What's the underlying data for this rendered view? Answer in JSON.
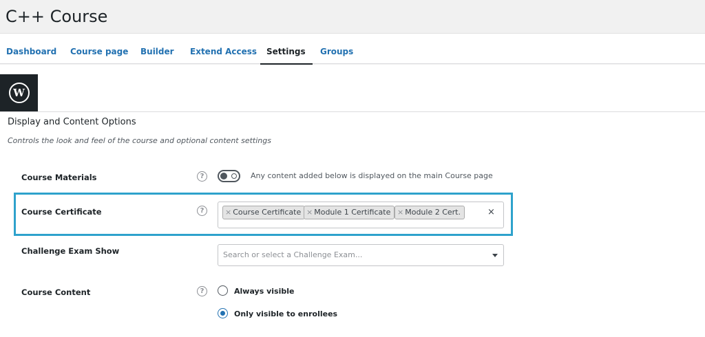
{
  "page": {
    "title": "C++ Course"
  },
  "tabs": [
    {
      "label": "Dashboard"
    },
    {
      "label": "Course page"
    },
    {
      "label": "Builder"
    },
    {
      "label": "Extend Access"
    },
    {
      "label": "Settings",
      "active": true
    },
    {
      "label": "Groups"
    }
  ],
  "section": {
    "title": "Display and Content Options",
    "description": "Controls the look and feel of the course and optional content settings"
  },
  "course_materials": {
    "label": "Course Materials",
    "help_glyph": "?",
    "enabled": false,
    "description": "Any content added below is displayed on the main Course page"
  },
  "course_certificate": {
    "label": "Course Certificate",
    "help_glyph": "?",
    "remove_glyph": "×",
    "clear_glyph": "×",
    "selected": [
      "Course Certificate",
      "Module 1 Certificate",
      "Module 2 Cert."
    ]
  },
  "challenge_exam": {
    "label": "Challenge Exam Show",
    "placeholder": "Search or select a Challenge Exam..."
  },
  "course_content": {
    "label": "Course Content",
    "help_glyph": "?",
    "options": [
      {
        "label": "Always visible",
        "checked": false
      },
      {
        "label": "Only visible to enrollees",
        "checked": true
      }
    ]
  },
  "logo": {
    "glyph": "W",
    "icon": "wordpress-logo"
  },
  "colors": {
    "accent": "#2271b1",
    "highlight": "#2ea2cc",
    "dark": "#1d2327"
  }
}
